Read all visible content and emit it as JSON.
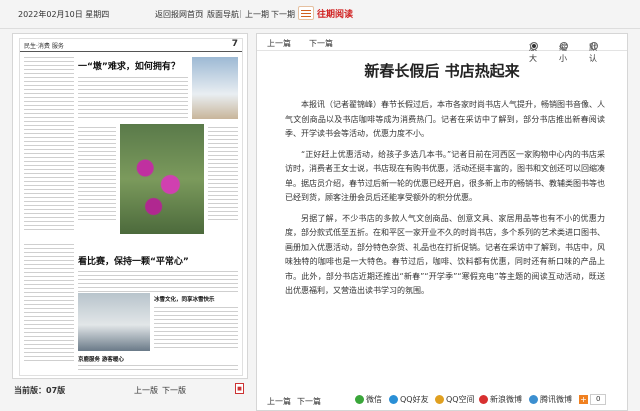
{
  "topbar": {
    "date": "2022年02月10日 星期四",
    "links": [
      "返回报网首页",
      "版面导航",
      "上一期",
      "下一期"
    ],
    "old_label": "往期阅读"
  },
  "paper": {
    "section": "民生·消费 服务",
    "page_no": "7",
    "headline1": "一“墩”难求，如何拥有？",
    "headline2": "看比赛，保持一颗“平常心”",
    "headline3": "冰雪文化，同享冰雪快乐",
    "headline4": "京鹿服务 游客暖心"
  },
  "bottombar": {
    "current": "当前版：07版",
    "prev": "上一版",
    "next": "下一版"
  },
  "article": {
    "prev": "上一篇",
    "next": "下一篇",
    "zoom_label": "放大",
    "mid_label": "缩小",
    "default_label": "默认",
    "title": "新春长假后  书店热起来",
    "paragraphs": [
      "本报讯（记者翟锦峰）春节长假过后，本市各家时尚书店人气提升，畅销图书音像、人气文创商品以及书店咖啡等成为消费热门。记者在采访中了解到，部分书店推出新春阅读季、开学读书会等活动，优惠力度不小。",
      "“正好赶上优惠活动，给孩子多选几本书。”记者日前在河西区一家购物中心内的书店采访时，消费者王女士说，书店现在有购书优惠，活动还挺丰富的，图书和文创还可以回缩凑单。据店员介绍，春节过后新一轮的优惠已经开启，很多新上市的畅销书、教辅类图书等也已经到货，顾客注册会员后还能享受额外的积分优惠。",
      "另据了解，不少书店的多款人气文创商品、创意文具、家居用品等也有不小的优惠力度，部分款式低至五折。在和平区一家开业不久的时尚书店，多个系列的艺术类进口图书、画册加入优惠活动，部分特色杂货、礼品也在打折促销。记者在采访中了解到，书店中，风味独特的咖啡也是一大特色。春节过后，咖啡、饮料都有优惠，同时还有新口味的产品上市。此外，部分书店近期还推出“新春”“开学季”“寒假充电”等主题的阅读互动活动，既送出优惠福利，又营造出读书学习的氛围。"
    ],
    "footer_prev": "上一篇",
    "footer_next": "下一篇",
    "share": [
      {
        "label": "微信",
        "color": "#3aa63a"
      },
      {
        "label": "QQ好友",
        "color": "#2a8fd6"
      },
      {
        "label": "QQ空间",
        "color": "#e0a020"
      },
      {
        "label": "新浪微博",
        "color": "#d83030"
      },
      {
        "label": "腾讯微博",
        "color": "#3c8fd0"
      }
    ],
    "count": "0"
  }
}
